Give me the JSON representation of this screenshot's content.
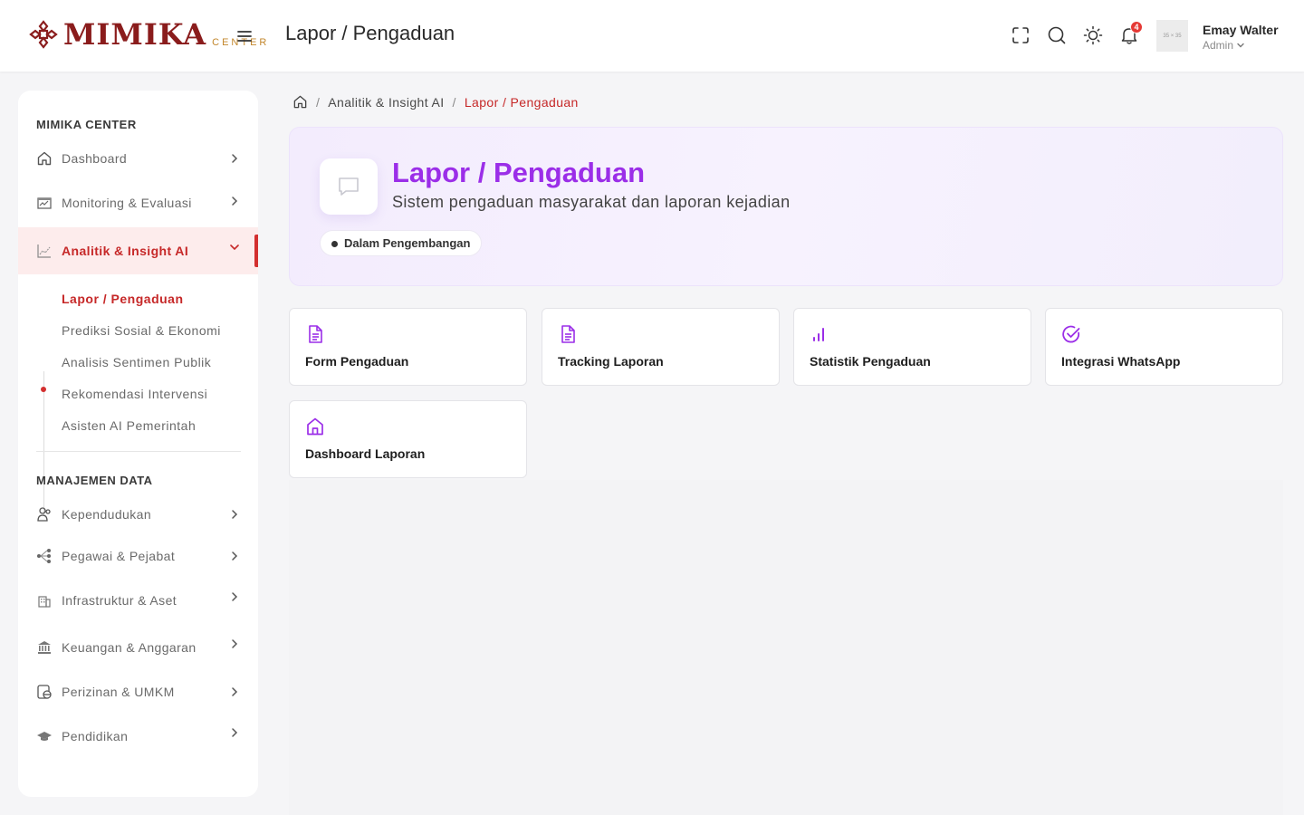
{
  "header": {
    "logo_text": "MIMIKA",
    "logo_sub": "CENTER",
    "page_title": "Lapor / Pengaduan",
    "notification_count": "4",
    "avatar_placeholder": "35 × 35",
    "user_name": "Emay Walter",
    "user_role": "Admin"
  },
  "sidebar": {
    "section1_title": "MIMIKA CENTER",
    "items1": [
      {
        "label": "Dashboard"
      },
      {
        "label": "Monitoring & Evaluasi"
      },
      {
        "label": "Analitik & Insight AI"
      }
    ],
    "subitems": [
      {
        "label": "Lapor / Pengaduan"
      },
      {
        "label": "Prediksi Sosial & Ekonomi"
      },
      {
        "label": "Analisis Sentimen Publik"
      },
      {
        "label": "Rekomendasi Intervensi"
      },
      {
        "label": "Asisten AI Pemerintah"
      }
    ],
    "section2_title": "MANAJEMEN DATA",
    "items2": [
      {
        "label": "Kependudukan"
      },
      {
        "label": "Pegawai & Pejabat"
      },
      {
        "label": "Infrastruktur & Aset"
      },
      {
        "label": "Keuangan & Anggaran"
      },
      {
        "label": "Perizinan & UMKM"
      },
      {
        "label": "Pendidikan"
      }
    ]
  },
  "breadcrumb": {
    "parent": "Analitik & Insight AI",
    "current": "Lapor / Pengaduan"
  },
  "hero": {
    "title": "Lapor / Pengaduan",
    "subtitle": "Sistem pengaduan masyarakat dan laporan kejadian",
    "status": "Dalam Pengembangan"
  },
  "cards": [
    {
      "label": "Form Pengaduan",
      "icon": "document-icon"
    },
    {
      "label": "Tracking Laporan",
      "icon": "document-icon"
    },
    {
      "label": "Statistik Pengaduan",
      "icon": "signal-bars-icon"
    },
    {
      "label": "Integrasi WhatsApp",
      "icon": "check-circle-icon"
    },
    {
      "label": "Dashboard Laporan",
      "icon": "home-icon"
    }
  ],
  "colors": {
    "accent_red": "#c62828",
    "accent_purple": "#9b2ee8",
    "logo_red": "#8a1c1c",
    "logo_gold": "#c2862b"
  }
}
